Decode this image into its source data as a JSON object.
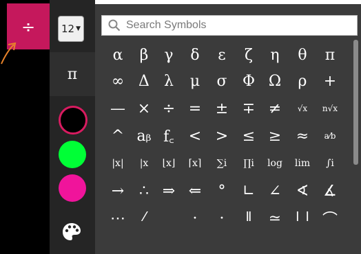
{
  "toolbar": {
    "math_button_symbol": "÷",
    "font_size": "12",
    "pi_tab_symbol": "π",
    "colors": [
      "#000000",
      "#00ff36",
      "#f0149b"
    ],
    "selected_color": "#000000"
  },
  "search": {
    "placeholder": "Search Symbols"
  },
  "symbols": {
    "rows": [
      [
        "α",
        "β",
        "γ",
        "δ",
        "ε",
        "ζ",
        "η",
        "θ",
        "π"
      ],
      [
        "∞",
        "Δ",
        "λ",
        "μ",
        "σ",
        "Φ",
        "Ω",
        "ρ",
        "+"
      ],
      [
        "—",
        "×",
        "÷",
        "=",
        "±",
        "∓",
        "≠",
        "√x",
        "n√x"
      ],
      [
        "^",
        "aᵦ",
        "f꜀",
        "<",
        ">",
        "≤",
        "≥",
        "≈",
        "a⁄b"
      ],
      [
        "|x|",
        "|x",
        "⌊x⌋",
        "⌈x⌉",
        "∑i",
        "∏i",
        "log",
        "lim",
        "∫i"
      ],
      [
        "→",
        "∴",
        "⇒",
        "⇐",
        "°",
        "∟",
        "∠",
        "∢",
        "∡"
      ],
      [
        "⋯",
        "⁄",
        "‥",
        "·",
        "·",
        "‖",
        "≃",
        "| |",
        "⌒"
      ]
    ]
  },
  "colors": {
    "accent": "#c5185c",
    "panel_bg": "#3b3b3b",
    "sidebar_bg": "#252525"
  }
}
